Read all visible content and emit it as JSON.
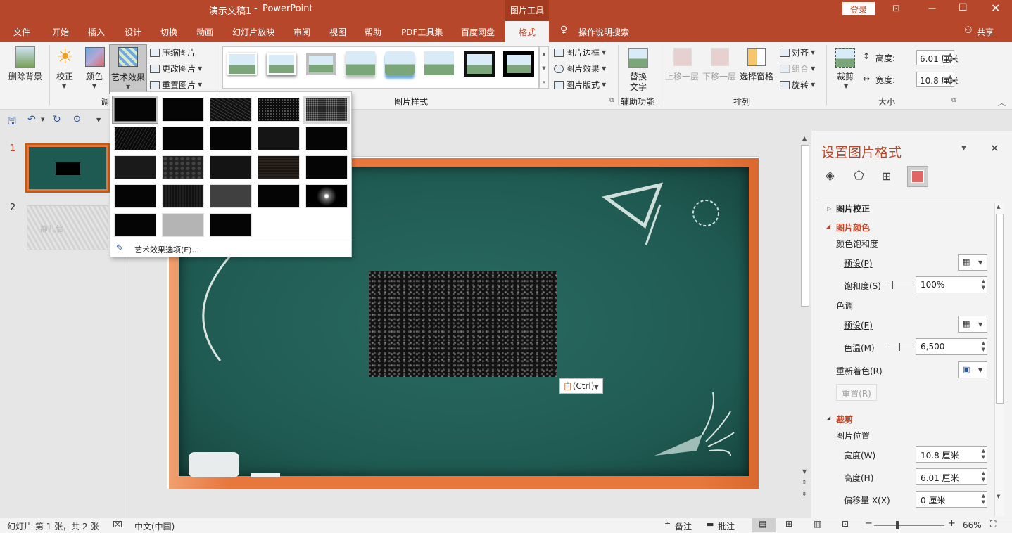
{
  "title": {
    "doc": "演示文稿1",
    "sep": "-",
    "app": "PowerPoint",
    "context_tab": "图片工具",
    "login": "登录"
  },
  "tabs": [
    "文件",
    "开始",
    "插入",
    "设计",
    "切换",
    "动画",
    "幻灯片放映",
    "审阅",
    "视图",
    "帮助",
    "PDF工具集",
    "百度网盘",
    "格式"
  ],
  "active_tab": "格式",
  "tell_me": "操作说明搜索",
  "share": "共享",
  "ribbon": {
    "remove_bg": "删除背景",
    "corrections": "校正",
    "color": "颜色",
    "artistic": "艺术效果",
    "compress": "压缩图片",
    "change": "更改图片",
    "reset": "重置图片",
    "adjust_group": "调",
    "styles_group": "图片样式",
    "border": "图片边框",
    "effects": "图片效果",
    "layout": "图片版式",
    "alt_text_1": "替换",
    "alt_text_2": "文字",
    "access_group": "辅助功能",
    "bring_forward": "上移一层",
    "send_backward": "下移一层",
    "selection_pane": "选择窗格",
    "align": "对齐",
    "group": "组合",
    "rotate": "旋转",
    "arrange_group": "排列",
    "crop": "裁剪",
    "height_label": "高度:",
    "height_value": "6.01 厘米",
    "width_label": "宽度:",
    "width_value": "10.8 厘米",
    "size_group": "大小"
  },
  "artistic_menu": {
    "options_label": "艺术效果选项(E)..."
  },
  "slides": [
    {
      "number": "1"
    },
    {
      "number": "2",
      "text": "静儿信"
    }
  ],
  "paste_ctrl": "(Ctrl)",
  "pane": {
    "title": "设置图片格式",
    "picture_corrections": "图片校正",
    "picture_color": "图片颜色",
    "color_saturation": "颜色饱和度",
    "preset_p": "预设(P)",
    "saturation_label": "饱和度(S)",
    "saturation_value": "100%",
    "color_tone": "色调",
    "preset_e": "预设(E)",
    "temperature_label": "色温(M)",
    "temperature_value": "6,500",
    "recolor": "重新着色(R)",
    "reset_btn": "重置(R)",
    "crop": "裁剪",
    "picture_position": "图片位置",
    "width_label": "宽度(W)",
    "width_value": "10.8 厘米",
    "height_label": "高度(H)",
    "height_value": "6.01 厘米",
    "offset_label": "偏移量 X(X)",
    "offset_value": "0 厘米"
  },
  "status": {
    "slide_info": "幻灯片 第 1 张，共 2 张",
    "language": "中文(中国)",
    "notes": "备注",
    "comments": "批注",
    "zoom": "66%"
  },
  "colors": {
    "accent": "#b7472a",
    "board": "#1f5a52",
    "frame": "#e8773d"
  }
}
